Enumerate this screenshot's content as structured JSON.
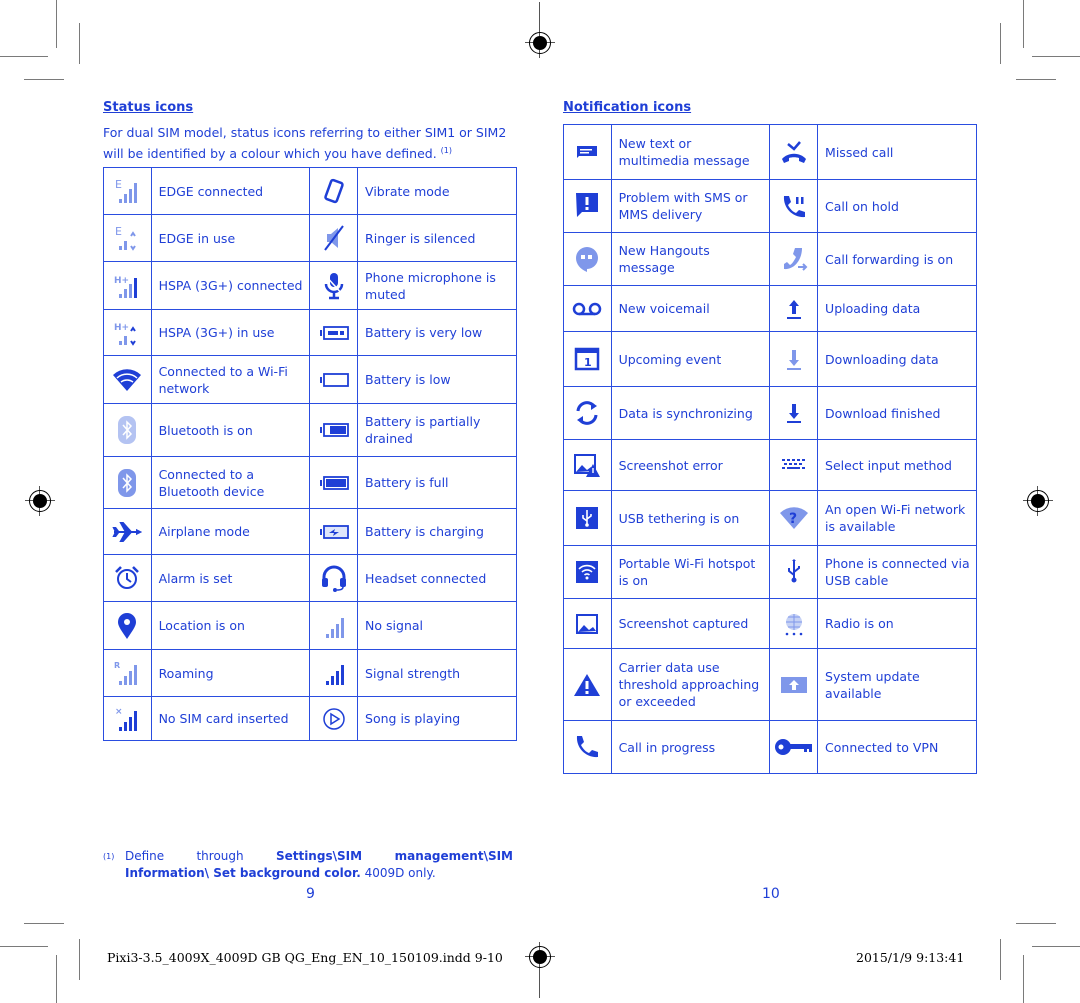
{
  "left_page": {
    "title": "Status icons",
    "intro": "For dual SIM model, status icons referring to either SIM1 or SIM2 will be identified by a colour which you have defined.",
    "intro_marker": "(1)",
    "rows": [
      {
        "left": {
          "icon": "edge-connected-icon",
          "label": "EDGE connected"
        },
        "right": {
          "icon": "vibrate-icon",
          "label": "Vibrate mode"
        }
      },
      {
        "left": {
          "icon": "edge-in-use-icon",
          "label": "EDGE in use"
        },
        "right": {
          "icon": "ringer-silenced-icon",
          "label": "Ringer is silenced"
        }
      },
      {
        "left": {
          "icon": "hspa-connected-icon",
          "label": "HSPA (3G+) connected"
        },
        "right": {
          "icon": "microphone-muted-icon",
          "label": "Phone microphone is muted"
        }
      },
      {
        "left": {
          "icon": "hspa-in-use-icon",
          "label": "HSPA (3G+) in use"
        },
        "right": {
          "icon": "battery-very-low-icon",
          "label": "Battery is very low"
        }
      },
      {
        "left": {
          "icon": "wifi-icon",
          "label": "Connected to a Wi-Fi network"
        },
        "right": {
          "icon": "battery-low-icon",
          "label": "Battery is low"
        }
      },
      {
        "left": {
          "icon": "bluetooth-on-icon",
          "label": "Bluetooth is on"
        },
        "right": {
          "icon": "battery-partial-icon",
          "label": "Battery is partially drained"
        }
      },
      {
        "left": {
          "icon": "bluetooth-connected-icon",
          "label": "Connected to a Bluetooth device"
        },
        "right": {
          "icon": "battery-full-icon",
          "label": "Battery is full"
        }
      },
      {
        "left": {
          "icon": "airplane-icon",
          "label": "Airplane mode"
        },
        "right": {
          "icon": "battery-charging-icon",
          "label": "Battery is charging"
        }
      },
      {
        "left": {
          "icon": "alarm-icon",
          "label": "Alarm is set"
        },
        "right": {
          "icon": "headset-icon",
          "label": "Headset connected"
        }
      },
      {
        "left": {
          "icon": "location-icon",
          "label": "Location is on"
        },
        "right": {
          "icon": "no-signal-icon",
          "label": "No signal"
        }
      },
      {
        "left": {
          "icon": "roaming-icon",
          "label": "Roaming"
        },
        "right": {
          "icon": "signal-strength-icon",
          "label": "Signal strength"
        }
      },
      {
        "left": {
          "icon": "no-sim-icon",
          "label": "No SIM card inserted"
        },
        "right": {
          "icon": "play-icon",
          "label": "Song is playing"
        }
      }
    ],
    "footnote": {
      "marker": "(1)",
      "text_pre": "Define through ",
      "text_bold": "Settings\\SIM management\\SIM Information\\ Set background color.",
      "text_post": " 4009D only."
    },
    "page_number": "9"
  },
  "right_page": {
    "title": "Notification icons",
    "rows": [
      {
        "left": {
          "icon": "new-message-icon",
          "label": "New text or multimedia message"
        },
        "right": {
          "icon": "missed-call-icon",
          "label": "Missed call"
        }
      },
      {
        "left": {
          "icon": "sms-problem-icon",
          "label": "Problem with SMS or MMS delivery"
        },
        "right": {
          "icon": "call-on-hold-icon",
          "label": "Call on hold"
        }
      },
      {
        "left": {
          "icon": "hangouts-icon",
          "label": "New Hangouts message"
        },
        "right": {
          "icon": "call-forwarding-icon",
          "label": "Call forwarding is on"
        }
      },
      {
        "left": {
          "icon": "voicemail-icon",
          "label": "New voicemail"
        },
        "right": {
          "icon": "upload-icon",
          "label": "Uploading data"
        }
      },
      {
        "left": {
          "icon": "calendar-icon",
          "label": "Upcoming event"
        },
        "right": {
          "icon": "downloading-icon",
          "label": "Downloading data"
        }
      },
      {
        "left": {
          "icon": "sync-icon",
          "label": "Data is synchronizing"
        },
        "right": {
          "icon": "download-finished-icon",
          "label": "Download finished"
        }
      },
      {
        "left": {
          "icon": "screenshot-error-icon",
          "label": "Screenshot error"
        },
        "right": {
          "icon": "keyboard-icon",
          "label": "Select input method"
        }
      },
      {
        "left": {
          "icon": "usb-tethering-icon",
          "label": "USB tethering is on"
        },
        "right": {
          "icon": "open-wifi-icon",
          "label": "An open Wi-Fi network is available"
        }
      },
      {
        "left": {
          "icon": "hotspot-icon",
          "label": "Portable Wi-Fi hotspot is on"
        },
        "right": {
          "icon": "usb-icon",
          "label": "Phone is connected via USB cable"
        }
      },
      {
        "left": {
          "icon": "screenshot-icon",
          "label": "Screenshot captured"
        },
        "right": {
          "icon": "radio-icon",
          "label": "Radio is on"
        }
      },
      {
        "left": {
          "icon": "warning-icon",
          "label": "Carrier data use threshold approaching or exceeded"
        },
        "right": {
          "icon": "system-update-icon",
          "label": "System update available"
        }
      },
      {
        "left": {
          "icon": "call-icon",
          "label": "Call in progress"
        },
        "right": {
          "icon": "vpn-key-icon",
          "label": "Connected to VPN"
        }
      }
    ],
    "page_number": "10"
  },
  "slug": {
    "filename": "Pixi3-3.5_4009X_4009D GB QG_Eng_EN_10_150109.indd  9-10",
    "timestamp": "2015/1/9  9:13:41"
  },
  "colors": {
    "text": "#1f3fd6",
    "border": "#2a4de0",
    "icon": "#1f3fd6",
    "icon_light": "#7f97ea"
  }
}
